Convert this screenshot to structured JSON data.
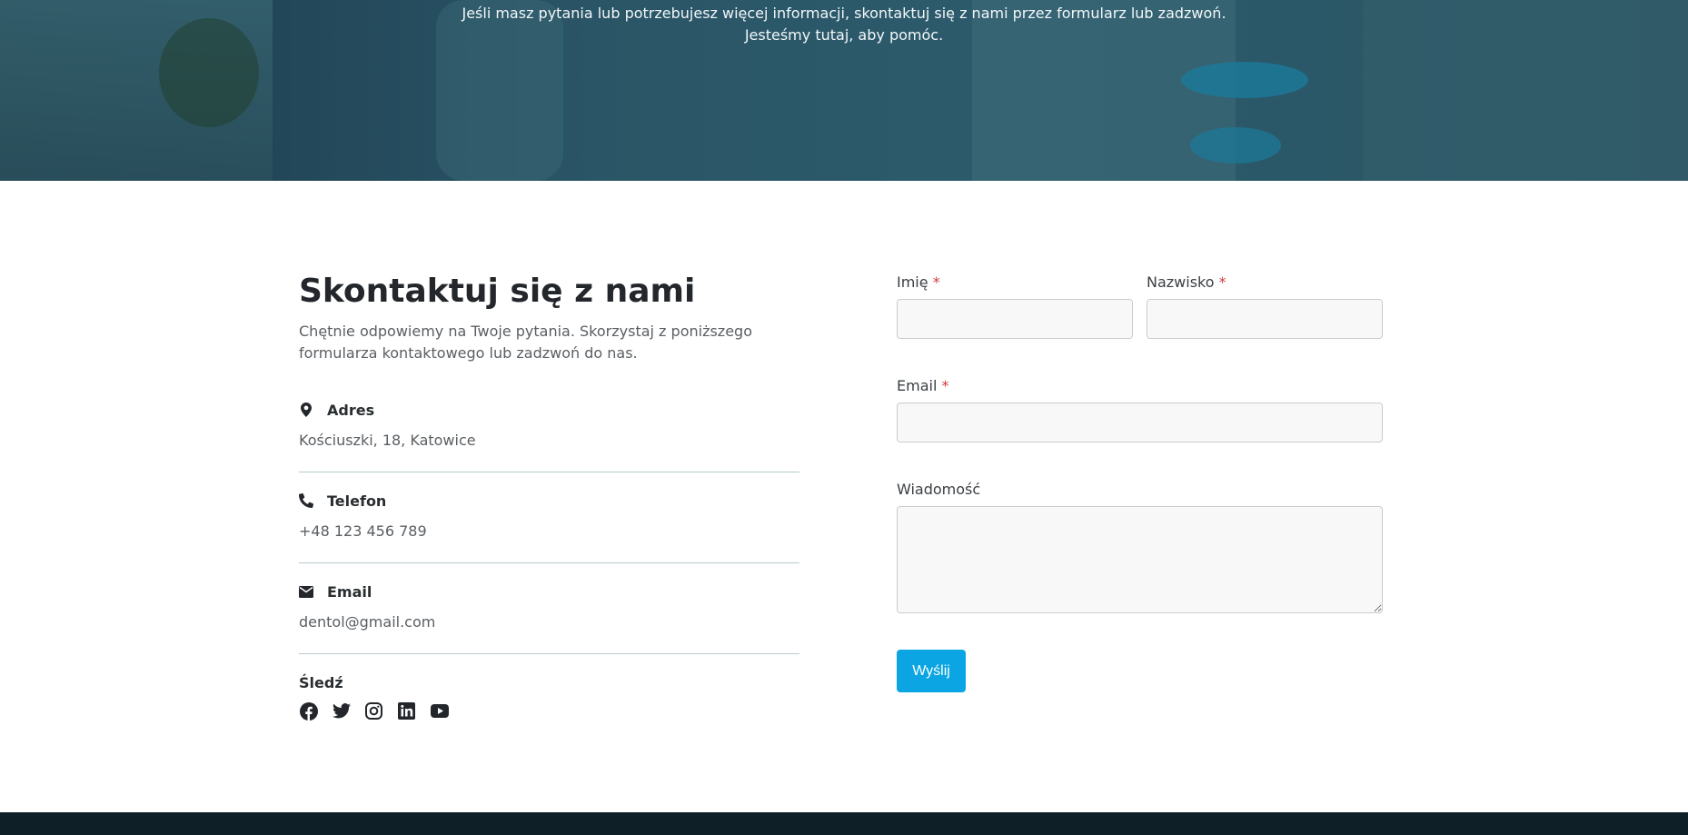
{
  "hero": {
    "line1": "Jeśli masz pytania lub potrzebujesz więcej informacji, skontaktuj się z nami przez formularz lub zadzwoń.",
    "line2": "Jesteśmy tutaj, aby pomóc."
  },
  "contact": {
    "title": "Skontaktuj się z nami",
    "intro": "Chętnie odpowiemy na Twoje pytania. Skorzystaj z poniższego formularza kontaktowego lub zadzwoń do nas.",
    "items": [
      {
        "icon": "map-marker-icon",
        "label": "Adres",
        "value": "Kościuszki, 18, Katowice"
      },
      {
        "icon": "phone-icon",
        "label": "Telefon",
        "value": "+48 123 456 789"
      },
      {
        "icon": "envelope-icon",
        "label": "Email",
        "value": "dentol@gmail.com"
      }
    ],
    "follow_label": "Śledź",
    "socials": [
      "facebook-icon",
      "twitter-icon",
      "instagram-icon",
      "linkedin-icon",
      "youtube-icon"
    ]
  },
  "form": {
    "first_name_label": "Imię",
    "last_name_label": "Nazwisko",
    "email_label": "Email",
    "message_label": "Wiadomość",
    "required_mark": "*",
    "first_name_value": "",
    "last_name_value": "",
    "email_value": "",
    "message_value": "",
    "submit_label": "Wyślij"
  },
  "colors": {
    "accent": "#0aa5e2",
    "required": "#d23b3b",
    "footer": "#0e1f27"
  }
}
